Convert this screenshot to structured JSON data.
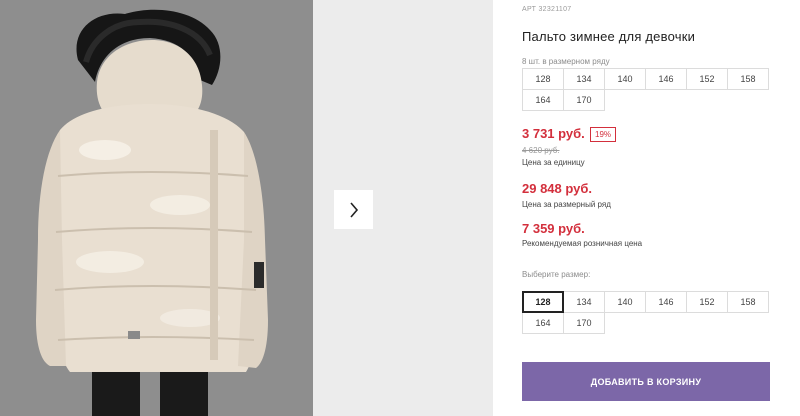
{
  "product": {
    "sku": "АРТ 32321107",
    "title": "Пальто зимнее для девочки",
    "pack_caption": "8 шт. в размерном ряду",
    "pack_sizes": [
      "128",
      "134",
      "140",
      "146",
      "152",
      "158",
      "164",
      "170"
    ],
    "price": "3 731 руб.",
    "discount": "19%",
    "old_price": "4 620 руб.",
    "unit_price_label": "Цена за единицу",
    "row_price": "29 848 руб.",
    "row_price_label": "Цена за размерный ряд",
    "retail_price": "7 359 руб.",
    "retail_price_label": "Рекомендуемая розничная цена",
    "choose_size_label": "Выберите размер:",
    "sizes": [
      "128",
      "134",
      "140",
      "146",
      "152",
      "158",
      "164",
      "170"
    ],
    "selected_size": "128",
    "add_to_cart_label": "ДОБАВИТЬ В КОРЗИНУ"
  },
  "gallery": {
    "next_icon": "chevron-right-icon"
  },
  "colors": {
    "price_red": "#d32f3c",
    "cart_button": "#7c67a8",
    "jacket": "#e8ddd0",
    "fur": "#1a1a1a"
  }
}
